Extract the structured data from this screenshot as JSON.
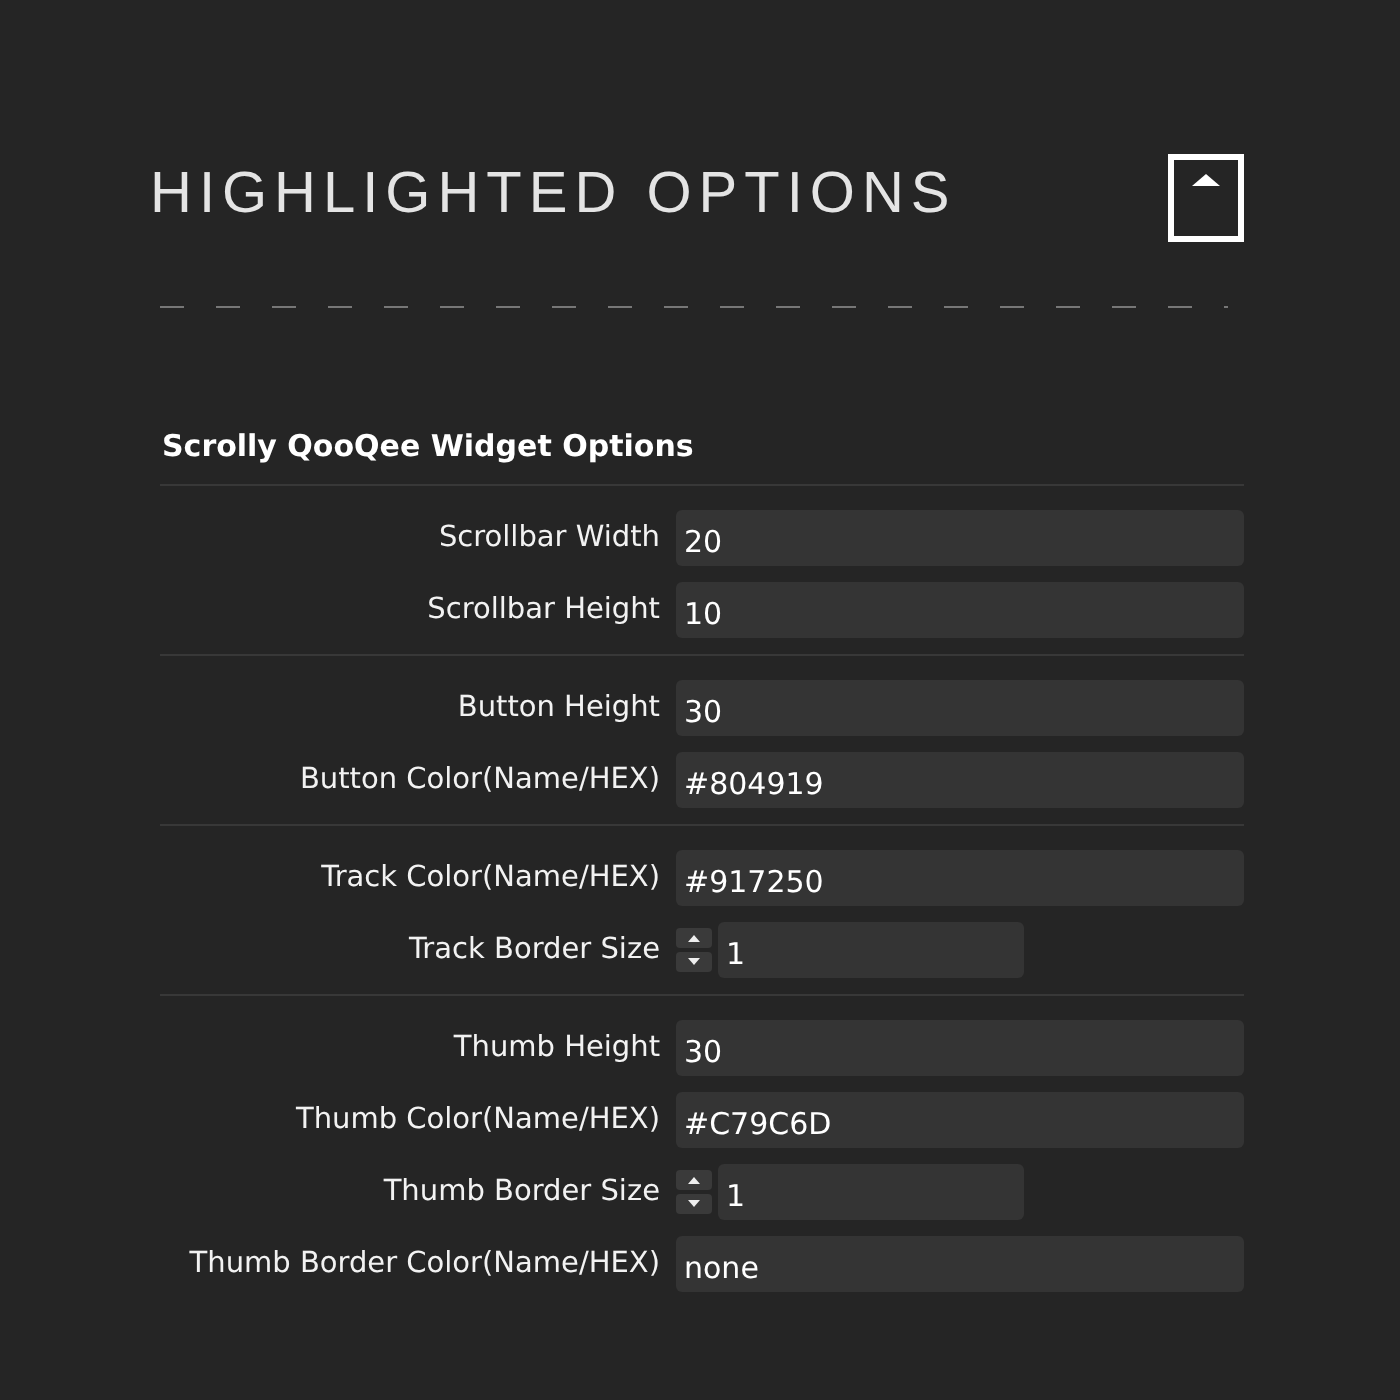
{
  "header": {
    "title": "HIGHLIGHTED OPTIONS"
  },
  "section": {
    "title": "Scrolly QooQee Widget Options",
    "groups": [
      {
        "fields": [
          {
            "kind": "text",
            "label": "Scrollbar Width",
            "value": "20"
          },
          {
            "kind": "text",
            "label": "Scrollbar Height",
            "value": "10"
          }
        ]
      },
      {
        "fields": [
          {
            "kind": "text",
            "label": "Button Height",
            "value": "30"
          },
          {
            "kind": "text",
            "label": "Button Color(Name/HEX)",
            "value": "#804919"
          }
        ]
      },
      {
        "fields": [
          {
            "kind": "text",
            "label": "Track Color(Name/HEX)",
            "value": "#917250"
          },
          {
            "kind": "number",
            "label": "Track Border Size",
            "value": "1"
          }
        ]
      },
      {
        "fields": [
          {
            "kind": "text",
            "label": "Thumb Height",
            "value": "30"
          },
          {
            "kind": "text",
            "label": "Thumb Color(Name/HEX)",
            "value": "#C79C6D"
          },
          {
            "kind": "number",
            "label": "Thumb Border Size",
            "value": "1"
          },
          {
            "kind": "text",
            "label": "Thumb Border Color(Name/HEX)",
            "value": "none"
          }
        ]
      }
    ]
  }
}
